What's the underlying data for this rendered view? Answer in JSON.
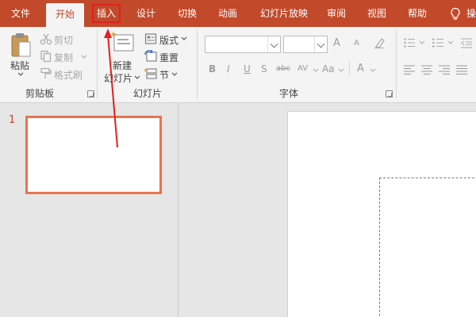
{
  "tabs": [
    "文件",
    "开始",
    "插入",
    "设计",
    "切换",
    "动画",
    "幻灯片放映",
    "审阅",
    "视图",
    "帮助"
  ],
  "active_tab": "开始",
  "highlighted_tab": "插入",
  "tell_me": {
    "icon": "lightbulb-icon",
    "label": "操"
  },
  "clipboard": {
    "paste_label": "粘贴",
    "cut_label": "剪切",
    "copy_label": "复制",
    "format_painter_label": "格式刷",
    "group_label": "剪贴板"
  },
  "slides_group": {
    "new_slide_label_1": "新建",
    "new_slide_label_2": "幻灯片",
    "layout_label": "版式",
    "reset_label": "重置",
    "section_label": "节",
    "group_label": "幻灯片"
  },
  "font_group": {
    "font_name": "",
    "font_size": "",
    "grow_font": "A",
    "shrink_font": "A",
    "bold": "B",
    "italic": "I",
    "underline": "U",
    "shadow": "S",
    "strikethrough": "abc",
    "spacing": "AV",
    "change_case": "Aa",
    "font_color": "A",
    "group_label": "字体"
  },
  "thumbnail_pane": {
    "slide_number": "1"
  },
  "colors": {
    "accent": "#c2492a",
    "thumb_border": "#e9744f",
    "highlight_box": "#e02020",
    "annotation_arrow": "#e02020"
  }
}
